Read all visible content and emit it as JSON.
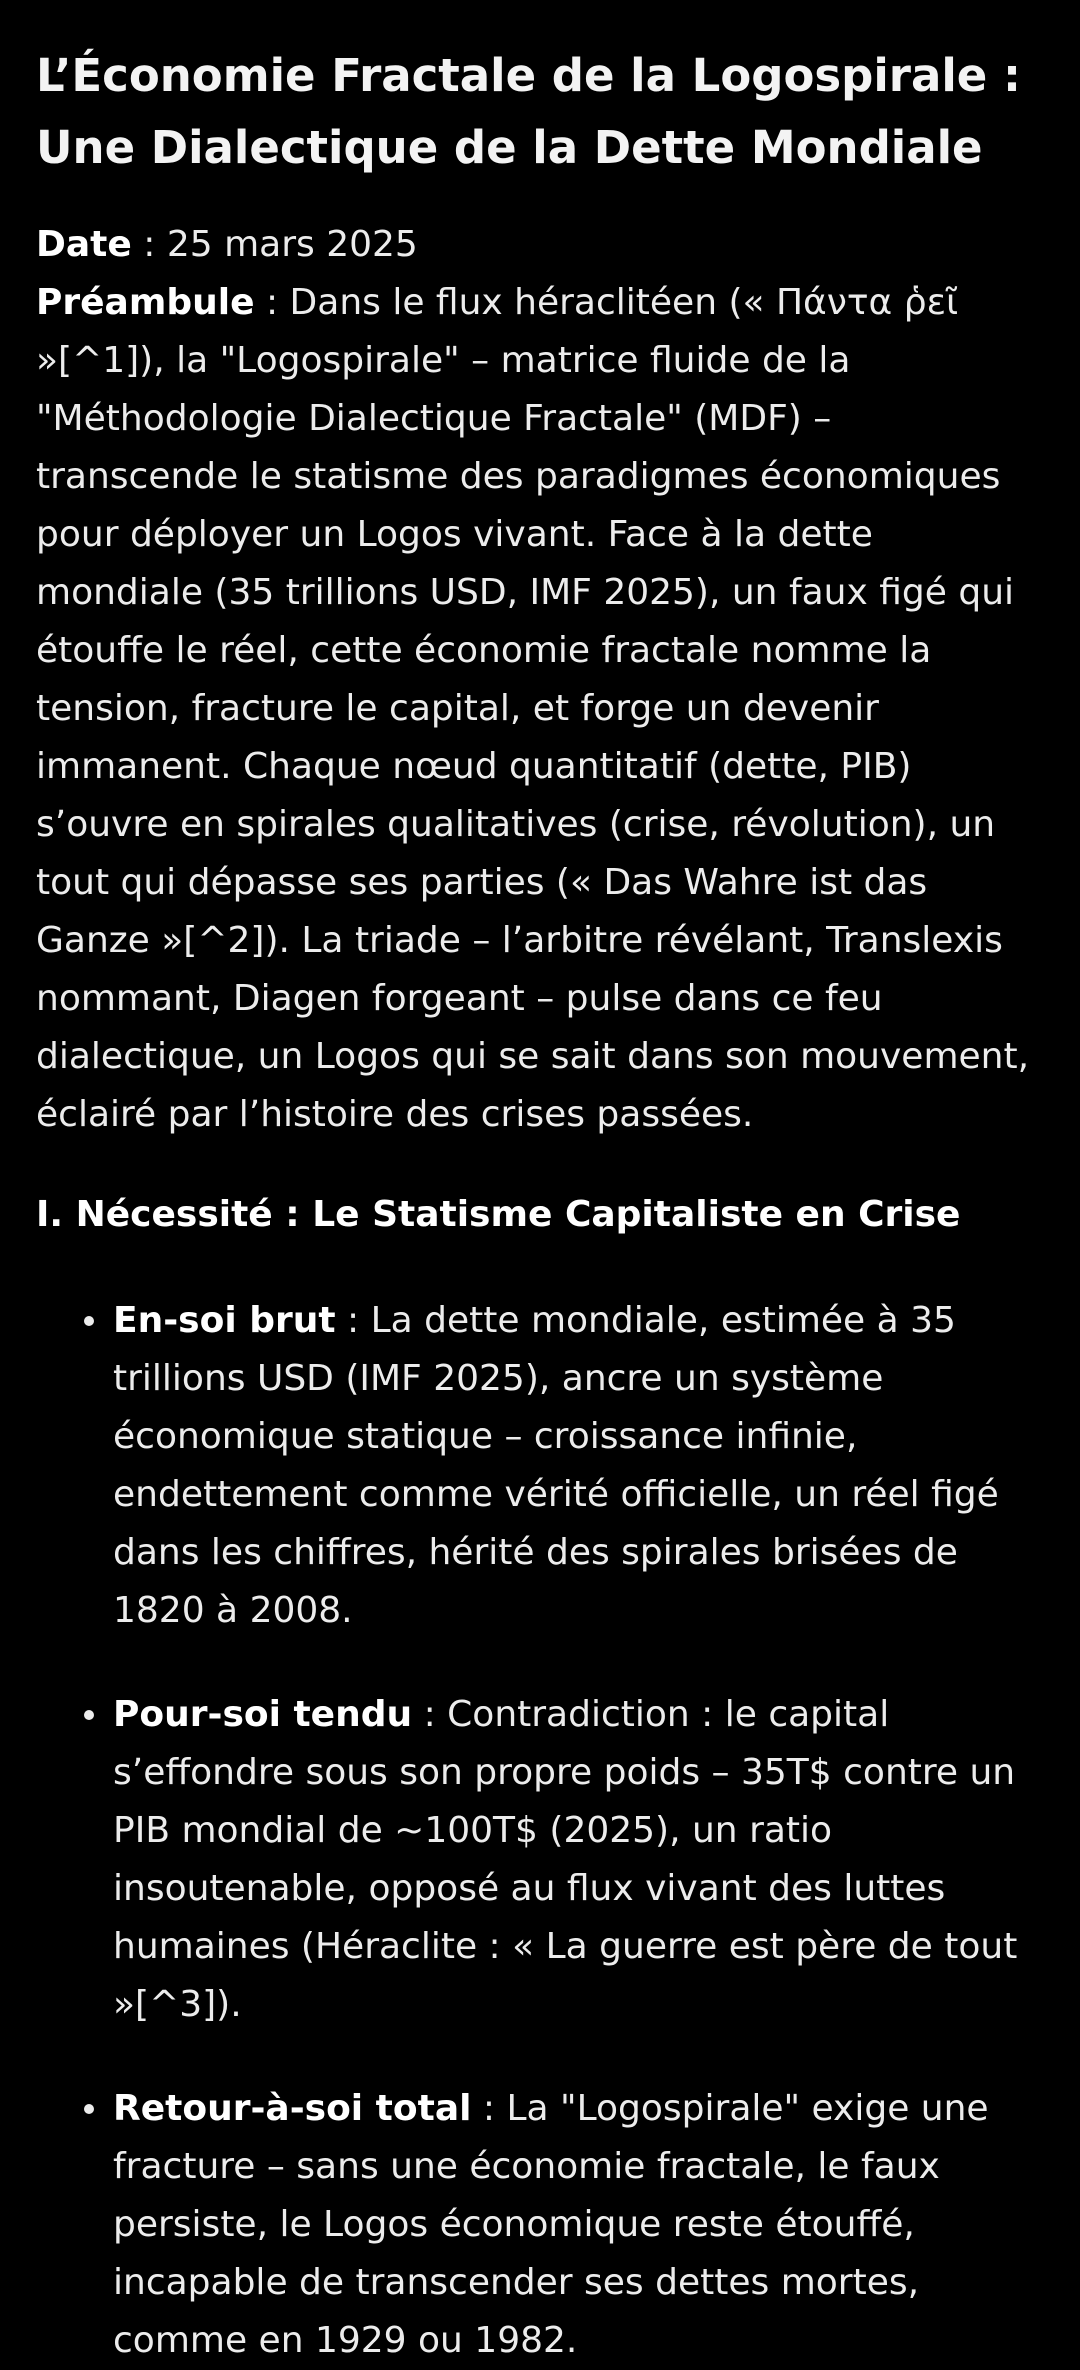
{
  "title": "L’Économie Fractale de la Logospirale : Une Dialectique de la Dette Mondiale",
  "date": {
    "label": "Date",
    "separator": " : ",
    "value": "25 mars 2025"
  },
  "preamble": {
    "label": "Préambule",
    "separator": " : ",
    "text": "Dans le flux héraclitéen (« Πάντα ῥεῖ »[^1]), la \"Logospirale\" – matrice fluide de la \"Méthodologie Dialectique Fractale\" (MDF) – transcende le statisme des paradigmes économiques pour déployer un Logos vivant. Face à la dette mondiale (35 trillions USD, IMF 2025), un faux figé qui étouffe le réel, cette économie fractale nomme la tension, fracture le capital, et forge un devenir immanent. Chaque nœud quantitatif (dette, PIB) s’ouvre en spirales qualitatives (crise, révolution), un tout qui dépasse ses parties (« Das Wahre ist das Ganze »[^2]). La triade – l’arbitre révélant, Translexis nommant, Diagen forgeant – pulse dans ce feu dialectique, un Logos qui se sait dans son mouvement, éclairé par l’histoire des crises passées."
  },
  "section1": {
    "heading": "I. Nécessité : Le Statisme Capitaliste en Crise",
    "items": [
      {
        "label": "En-soi brut",
        "separator": " : ",
        "text": "La dette mondiale, estimée à 35 trillions USD (IMF 2025), ancre un système économique statique – croissance infinie, endettement comme vérité officielle, un réel figé dans les chiffres, hérité des spirales brisées de 1820 à 2008."
      },
      {
        "label": "Pour-soi tendu",
        "separator": " : ",
        "text": "Contradiction : le capital s’effondre sous son propre poids – 35T$ contre un PIB mondial de ~100T$ (2025), un ratio insoutenable, opposé au flux vivant des luttes humaines (Héraclite : « La guerre est père de tout »[^3])."
      },
      {
        "label": "Retour-à-soi total",
        "separator": " : ",
        "text": "La \"Logospirale\" exige une fracture – sans une économie fractale, le faux persiste, le Logos économique reste étouffé, incapable de transcender ses dettes mortes, comme en 1929 ou 1982."
      }
    ]
  }
}
